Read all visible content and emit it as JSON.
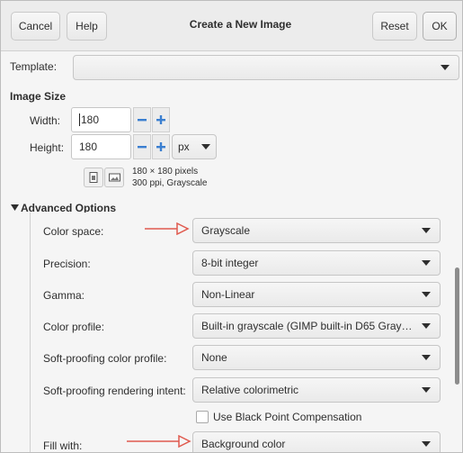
{
  "header": {
    "cancel_label": "Cancel",
    "help_label": "Help",
    "title": "Create a New Image",
    "reset_label": "Reset",
    "ok_label": "OK"
  },
  "template": {
    "label": "Template:",
    "value": ""
  },
  "image_size": {
    "section_label": "Image Size",
    "width_label": "Width:",
    "width_value": "180",
    "height_label": "Height:",
    "height_value": "180",
    "unit": "px",
    "info_line1": "180 × 180 pixels",
    "info_line2": "300 ppi, Grayscale"
  },
  "advanced": {
    "section_label": "Advanced Options",
    "rows": [
      {
        "label": "Color space:",
        "value": "Grayscale"
      },
      {
        "label": "Precision:",
        "value": "8-bit integer"
      },
      {
        "label": "Gamma:",
        "value": "Non-Linear"
      },
      {
        "label": "Color profile:",
        "value": "Built-in grayscale (GIMP built-in D65 Gray…"
      },
      {
        "label": "Soft-proofing color profile:",
        "value": "None"
      },
      {
        "label": "Soft-proofing rendering intent:",
        "value": "Relative colorimetric"
      },
      {
        "label": "Fill with:",
        "value": "Background color"
      }
    ],
    "black_point_label": "Use Black Point Compensation",
    "black_point_checked": false
  },
  "colors": {
    "annotation_arrow": "#e05a4e",
    "plus_icon": "#3b7fd0"
  },
  "icons": {
    "expander": "triangle-down-icon",
    "minus": "minus-icon",
    "plus": "plus-icon",
    "portrait": "portrait-icon",
    "landscape": "landscape-icon"
  }
}
